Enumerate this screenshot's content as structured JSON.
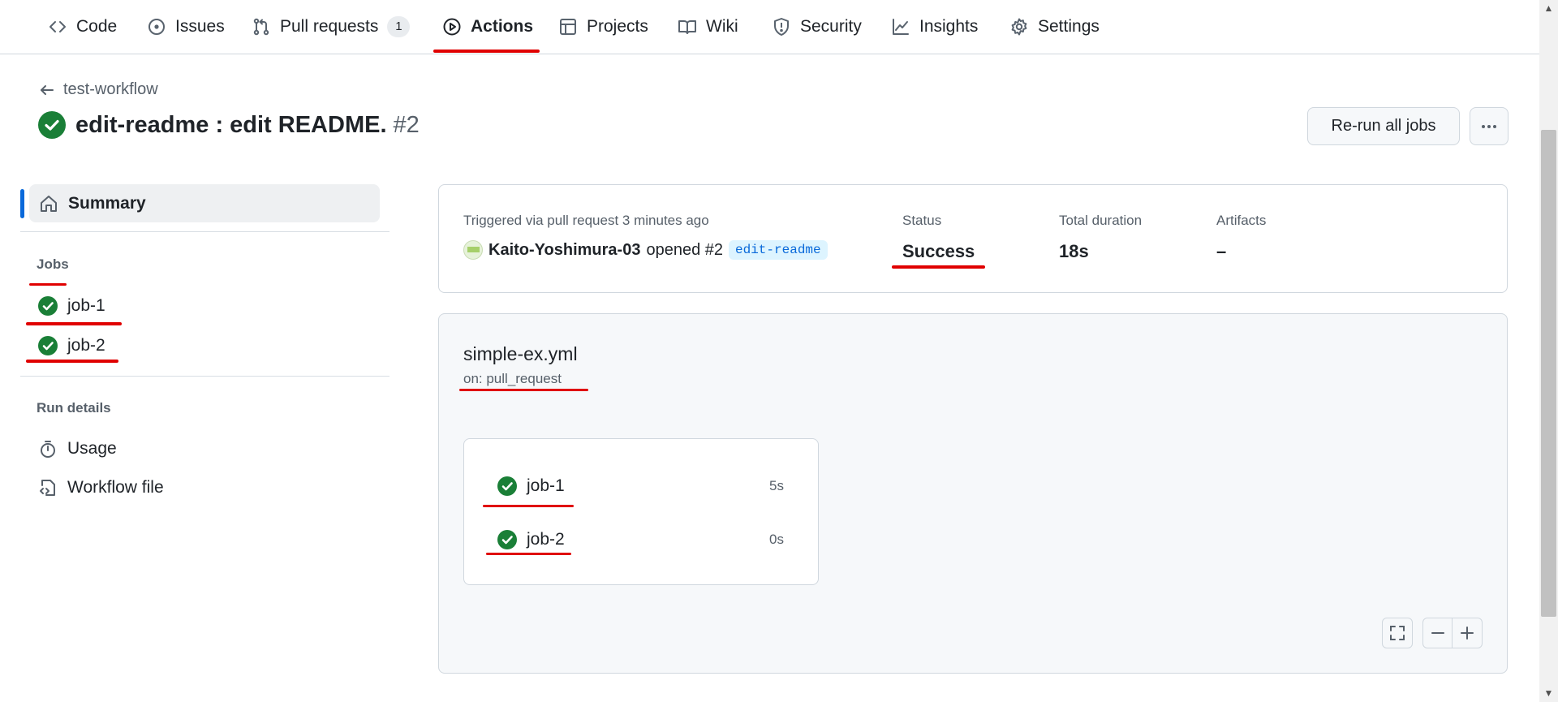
{
  "nav": {
    "items": [
      {
        "label": "Code",
        "icon": "code-icon"
      },
      {
        "label": "Issues",
        "icon": "issue-opened-icon"
      },
      {
        "label": "Pull requests",
        "icon": "git-pull-request-icon",
        "count": "1"
      },
      {
        "label": "Actions",
        "icon": "play-icon",
        "active": true
      },
      {
        "label": "Projects",
        "icon": "table-icon"
      },
      {
        "label": "Wiki",
        "icon": "book-icon"
      },
      {
        "label": "Security",
        "icon": "shield-icon"
      },
      {
        "label": "Insights",
        "icon": "graph-icon"
      },
      {
        "label": "Settings",
        "icon": "gear-icon"
      }
    ]
  },
  "header": {
    "back_label": "test-workflow",
    "title": "edit-readme : edit README.",
    "run_number": "#2",
    "rerun_label": "Re-run all jobs",
    "more_icon": "kebab-horizontal-icon"
  },
  "sidebar": {
    "summary_label": "Summary",
    "jobs_heading": "Jobs",
    "jobs": [
      {
        "label": "job-1",
        "status": "success"
      },
      {
        "label": "job-2",
        "status": "success"
      }
    ],
    "run_details_heading": "Run details",
    "details": [
      {
        "label": "Usage",
        "icon": "stopwatch-icon"
      },
      {
        "label": "Workflow file",
        "icon": "file-code-icon"
      }
    ]
  },
  "summary": {
    "trigger_text": "Triggered via pull request 3 minutes ago",
    "actor": "Kaito-Yoshimura-03",
    "action": "opened #2",
    "branch": "edit-readme",
    "status_label": "Status",
    "status_value": "Success",
    "duration_label": "Total duration",
    "duration_value": "18s",
    "artifacts_label": "Artifacts",
    "artifacts_value": "–"
  },
  "workflow": {
    "file": "simple-ex.yml",
    "trigger": "on: pull_request",
    "jobs": [
      {
        "label": "job-1",
        "duration": "5s"
      },
      {
        "label": "job-2",
        "duration": "0s"
      }
    ]
  },
  "colors": {
    "success": "#1a7f37",
    "accent": "#0969da",
    "annotation": "#e00000"
  }
}
